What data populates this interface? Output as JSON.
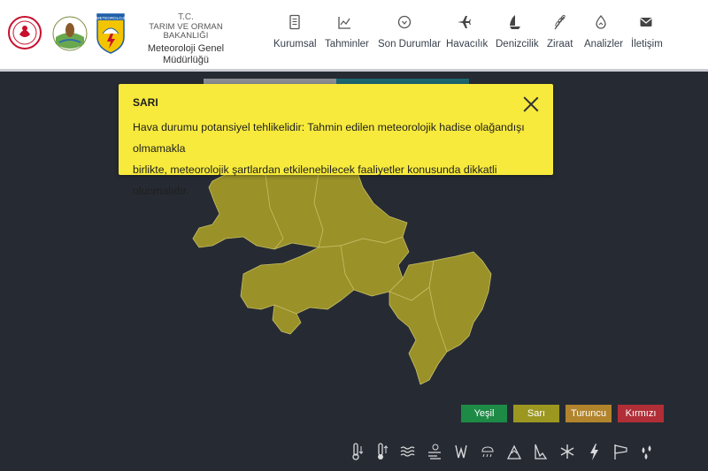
{
  "header": {
    "org_line1": "T.C.",
    "org_line2": "TARIM VE ORMAN BAKANLIĞI",
    "org_line3": "Meteoroloji Genel Müdürlüğü",
    "logo3_text": "METEOROLOJİ"
  },
  "nav": [
    {
      "label": "Kurumsal",
      "icon": "document-icon"
    },
    {
      "label": "Tahminler",
      "icon": "chart-icon"
    },
    {
      "label": "Son Durumlar",
      "icon": "compass-icon"
    },
    {
      "label": "Havacılık",
      "icon": "plane-icon"
    },
    {
      "label": "Denizcilik",
      "icon": "sailboat-icon"
    },
    {
      "label": "Ziraat",
      "icon": "wheat-icon"
    },
    {
      "label": "Analizler",
      "icon": "drop-icon"
    },
    {
      "label": "İletişim",
      "icon": "mail-icon"
    }
  ],
  "alert": {
    "title": "SARI",
    "text_line1": "Hava durumu potansiyel tehlikelidir: Tahmin edilen meteorolojik hadise olağandışı olmamakla",
    "text_line2": "birlikte, meteorolojik şartlardan etkilenebilecek faaliyetler konusunda dikkatli olunmalıdır.",
    "color": "#f7ea3c"
  },
  "legend": [
    {
      "label": "Yeşil",
      "color": "#1d8a45"
    },
    {
      "label": "Sarı",
      "color": "#9c9721"
    },
    {
      "label": "Turuncu",
      "color": "#b2842c"
    },
    {
      "label": "Kırmızı",
      "color": "#b12e37"
    }
  ],
  "map": {
    "fill_color": "#9a9128"
  },
  "weather_icons": [
    "cold-thermometer-icon",
    "hot-thermometer-icon",
    "fog-icon",
    "dust-icon",
    "wind-icon",
    "snow-rain-icon",
    "avalanche-icon",
    "ice-icon",
    "snowflake-icon",
    "lightning-icon",
    "windsock-icon",
    "rain-icon"
  ]
}
